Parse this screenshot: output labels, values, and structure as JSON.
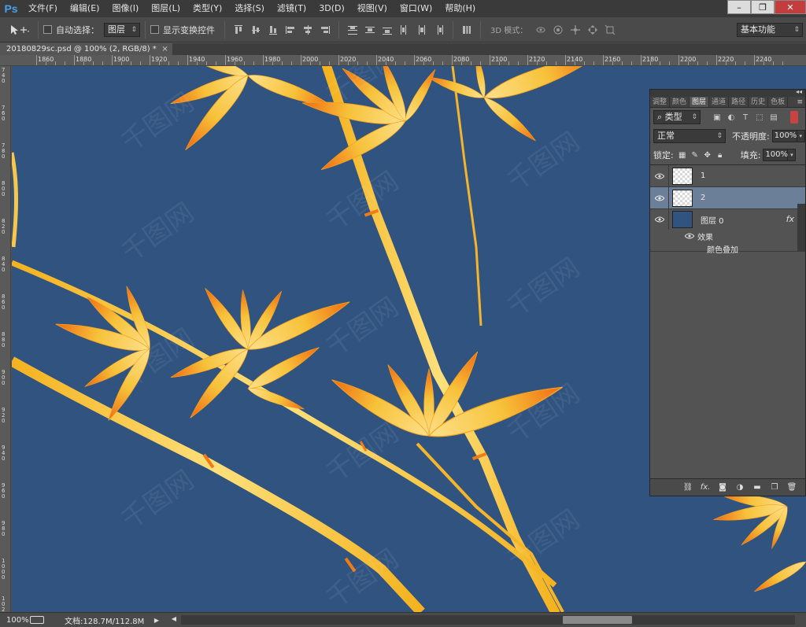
{
  "menubar": {
    "logo": "Ps",
    "items": [
      "文件(F)",
      "编辑(E)",
      "图像(I)",
      "图层(L)",
      "类型(Y)",
      "选择(S)",
      "滤镜(T)",
      "3D(D)",
      "视图(V)",
      "窗口(W)",
      "帮助(H)"
    ],
    "window_buttons": [
      "–",
      "❐",
      "✕"
    ]
  },
  "options": {
    "auto_select_label": "自动选择：",
    "auto_select_value": "图层",
    "show_transform_label": "显示变换控件",
    "mode3d_label": "3D 模式：",
    "workspace": "基本功能"
  },
  "document": {
    "tab_title": "20180829sc.psd @ 100% (2, RGB/8) *",
    "close": "×"
  },
  "ruler": {
    "top_labels": [
      "1860",
      "1880",
      "1900",
      "1920",
      "1940",
      "1960",
      "1980",
      "2000",
      "2020",
      "2040",
      "2060",
      "2080",
      "2100",
      "2120",
      "2140",
      "2160",
      "2180",
      "2200",
      "2220",
      "2240"
    ],
    "left_labels": [
      "740",
      "760",
      "780",
      "800",
      "820",
      "840",
      "860",
      "880",
      "900",
      "920",
      "940",
      "960",
      "980",
      "1000",
      "1020"
    ]
  },
  "canvas": {
    "background": "#30537f",
    "leaf_color": "#f7c64a",
    "leaf_accent": "#f06a12",
    "watermark": "千图网"
  },
  "status": {
    "zoom": "100%",
    "doc_info": "文档:128.7M/112.8M"
  },
  "layers_panel": {
    "tabs": [
      "调整",
      "颜色",
      "图层",
      "通道",
      "路径",
      "历史",
      "色板"
    ],
    "active_tab": "图层",
    "filter_kind": "类型",
    "blend_mode": "正常",
    "opacity_label": "不透明度:",
    "opacity": "100%",
    "lock_label": "锁定:",
    "fill_label": "填充:",
    "fill": "100%",
    "layers": [
      {
        "name": "1",
        "selected": false,
        "thumb": "checker"
      },
      {
        "name": "2",
        "selected": true,
        "thumb": "checker"
      },
      {
        "name": "图层 0",
        "selected": false,
        "thumb": "fill",
        "fx": "fx"
      }
    ],
    "effects_label": "效果",
    "effect_item": "颜色叠加"
  }
}
